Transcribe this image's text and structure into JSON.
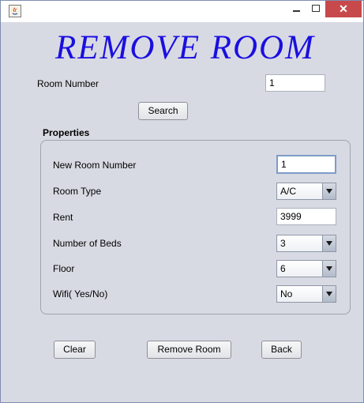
{
  "window": {
    "close_glyph": "✕",
    "maximize_glyph": "□"
  },
  "header": {
    "title": "REMOVE ROOM"
  },
  "search": {
    "room_number_label": "Room Number",
    "room_number_value": "1",
    "search_button": "Search"
  },
  "properties": {
    "section_title": "Properties",
    "new_room_number": {
      "label": "New Room Number",
      "value": "1"
    },
    "room_type": {
      "label": "Room Type",
      "selected": "A/C"
    },
    "rent": {
      "label": "Rent",
      "value": "3999"
    },
    "number_of_beds": {
      "label": "Number of Beds",
      "selected": "3"
    },
    "floor": {
      "label": "Floor",
      "selected": "6"
    },
    "wifi": {
      "label": "Wifi( Yes/No)",
      "selected": "No"
    }
  },
  "actions": {
    "clear": "Clear",
    "remove_room": "Remove Room",
    "back": "Back"
  },
  "colors": {
    "title_color": "#1a0fe0",
    "close_button": "#c7494b"
  }
}
